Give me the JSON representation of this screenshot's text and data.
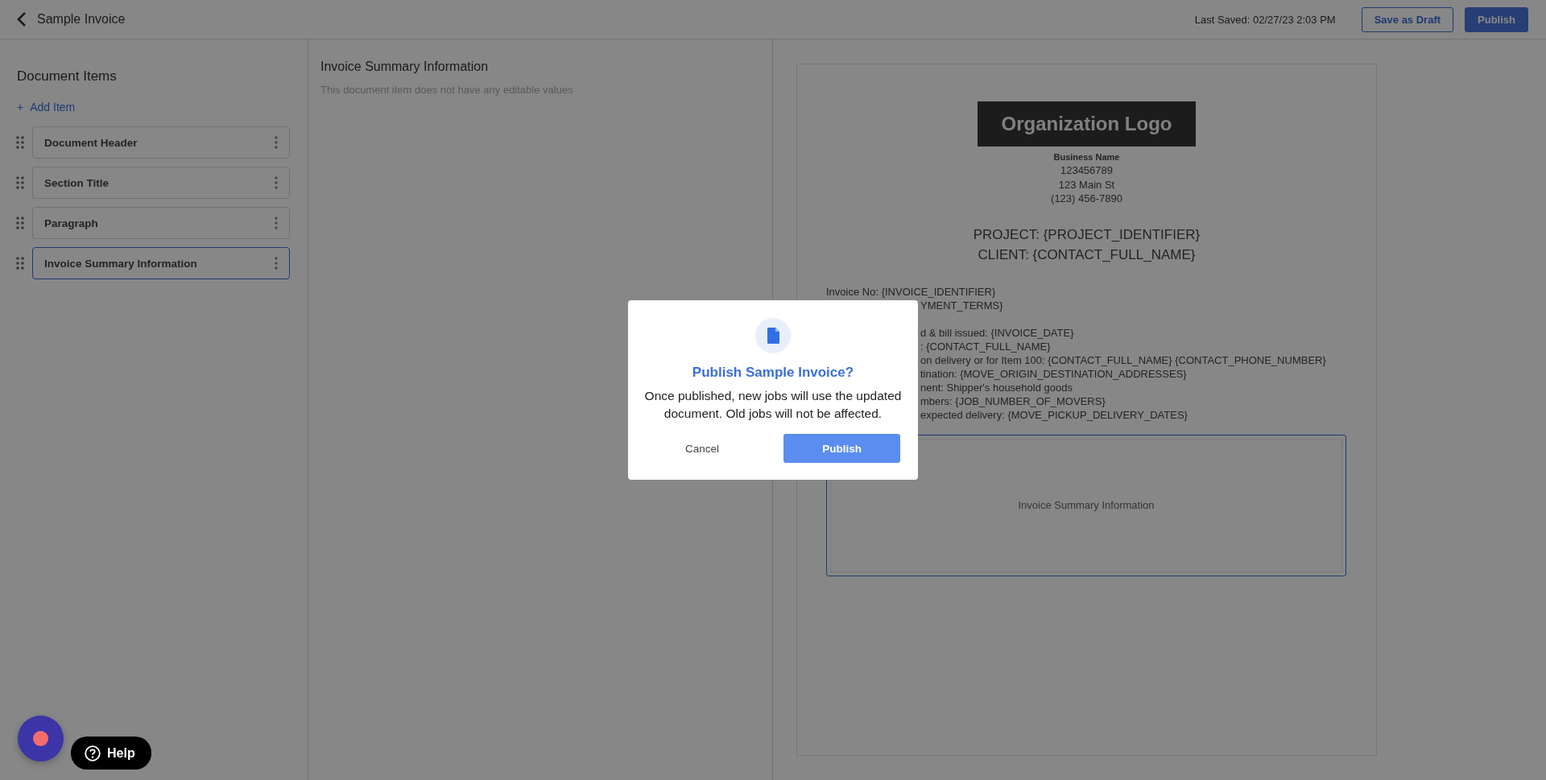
{
  "topbar": {
    "title": "Sample Invoice",
    "last_saved": "Last Saved: 02/27/23 2:03 PM",
    "buttons": [
      {
        "label": "Save as Draft",
        "kind": "outline"
      },
      {
        "label": "Publish",
        "kind": "primary"
      }
    ]
  },
  "sidebar": {
    "title": "Document Items",
    "add_icon": "+",
    "add_label": "Add Item",
    "items": [
      {
        "label": "Document Header",
        "selected": false
      },
      {
        "label": "Section Title",
        "selected": false
      },
      {
        "label": "Paragraph",
        "selected": false
      },
      {
        "label": "Invoice Summary Information",
        "selected": true
      }
    ]
  },
  "properties": {
    "title": "Invoice Summary Information",
    "note": "This document item does not have any editable values"
  },
  "preview": {
    "logo": "Organization Logo",
    "header_lines": [
      {
        "text": "Business Name",
        "kind": "name"
      },
      {
        "text": "123456789",
        "kind": "line"
      },
      {
        "text": "123 Main St",
        "kind": "line"
      },
      {
        "text": "(123) 456-7890",
        "kind": "line"
      }
    ],
    "headings": [
      "PROJECT: {PROJECT_IDENTIFIER}",
      "CLIENT: {CONTACT_FULL_NAME}"
    ],
    "field_groups": [
      [
        {
          "text": "Invoice No: {INVOICE_IDENTIFIER}",
          "kind": "full"
        },
        {
          "text": "YMENT_TERMS}",
          "kind": "clipped"
        }
      ],
      [
        {
          "text": "d & bill issued: {INVOICE_DATE}",
          "kind": "clipped"
        },
        {
          "text": ": {CONTACT_FULL_NAME}",
          "kind": "clipped"
        },
        {
          "text": "on delivery or for Item 100: {CONTACT_FULL_NAME} {CONTACT_PHONE_NUMBER}",
          "kind": "clipped"
        },
        {
          "text": "tination: {MOVE_ORIGIN_DESTINATION_ADDRESSES}",
          "kind": "clipped"
        },
        {
          "text": "nent: Shipper's household goods",
          "kind": "clipped"
        },
        {
          "text": "mbers: {JOB_NUMBER_OF_MOVERS}",
          "kind": "clipped"
        },
        {
          "text": "expected delivery: {MOVE_PICKUP_DELIVERY_DATES}",
          "kind": "clipped"
        }
      ]
    ],
    "summary_block": "Invoice Summary Information"
  },
  "dialog": {
    "title": "Publish Sample Invoice?",
    "message": "Once published, new jobs will use the updated document. Old jobs will not be affected.",
    "buttons": [
      {
        "label": "Cancel",
        "kind": "text"
      },
      {
        "label": "Publish",
        "kind": "primary"
      }
    ]
  },
  "help": {
    "label": "Help"
  }
}
